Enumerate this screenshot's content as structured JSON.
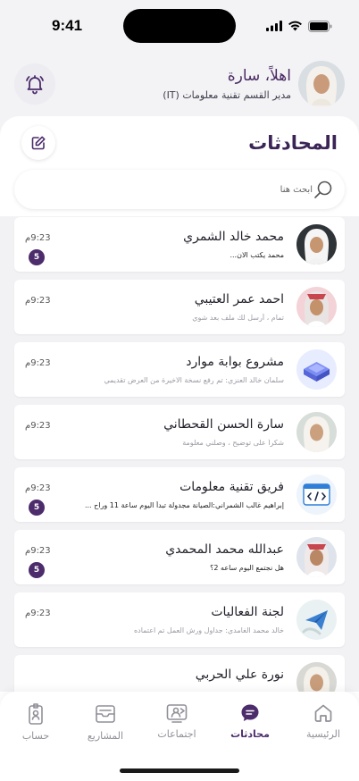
{
  "status_bar": {
    "time": "9:41"
  },
  "header": {
    "greeting": "اهلاً، سارة",
    "role": "مدير القسم تقنية معلومات (IT)"
  },
  "page": {
    "title": "المحادثات"
  },
  "search": {
    "placeholder": "ابحث هنا"
  },
  "chats": [
    {
      "name": "محمد خالد الشمري",
      "preview": "محمد يكتب الان...",
      "time": "9:23م",
      "badge": "5",
      "muted": false,
      "avatar": "man-ghutra"
    },
    {
      "name": "احمد عمر العتيبي",
      "preview": "تمام ، أرسل لك ملف بعد شوي",
      "time": "9:23م",
      "badge": "",
      "muted": true,
      "avatar": "man-shemagh"
    },
    {
      "name": "مشروع بوابة موارد",
      "preview": "سلمان خالد العنزي: تم رفع نسخة الاخيرة من العرض تقديمي",
      "time": "9:23م",
      "badge": "",
      "muted": true,
      "avatar": "project-cube"
    },
    {
      "name": "سارة الحسن القحطاني",
      "preview": "شكراً على توضيح ، وصلني معلومة",
      "time": "9:23م",
      "badge": "",
      "muted": true,
      "avatar": "woman-hijab"
    },
    {
      "name": "فريق تقنية معلومات",
      "preview": "إبراهيم غالب الشمراني:الصيانة مجدولة تبدأ اليوم ساعة 11 وراح ...",
      "time": "9:23م",
      "badge": "5",
      "muted": false,
      "avatar": "code-window"
    },
    {
      "name": "عبدالله محمد المحمدي",
      "preview": "هل نجتمع اليوم ساعه 2؟",
      "time": "9:23م",
      "badge": "5",
      "muted": false,
      "avatar": "man-shemagh"
    },
    {
      "name": "لجنة الفعاليات",
      "preview": "خالد محمد الغامدي: جداول ورش العمل تم اعتماده",
      "time": "9:23م",
      "badge": "",
      "muted": true,
      "avatar": "paper-plane"
    },
    {
      "name": "نورة علي الحربي",
      "preview": "",
      "time": "",
      "badge": "",
      "muted": true,
      "avatar": "woman-hijab"
    }
  ],
  "tabs": [
    {
      "label": "الرئيسية",
      "icon": "home-icon",
      "active": false
    },
    {
      "label": "محادثات",
      "icon": "chat-icon",
      "active": true
    },
    {
      "label": "اجتماعات",
      "icon": "meeting-icon",
      "active": false
    },
    {
      "label": "المشاريع",
      "icon": "projects-icon",
      "active": false
    },
    {
      "label": "حساب",
      "icon": "account-icon",
      "active": false
    }
  ],
  "colors": {
    "accent": "#4c2c6b",
    "title": "#3b2456",
    "badge": "#4c2c6b"
  }
}
